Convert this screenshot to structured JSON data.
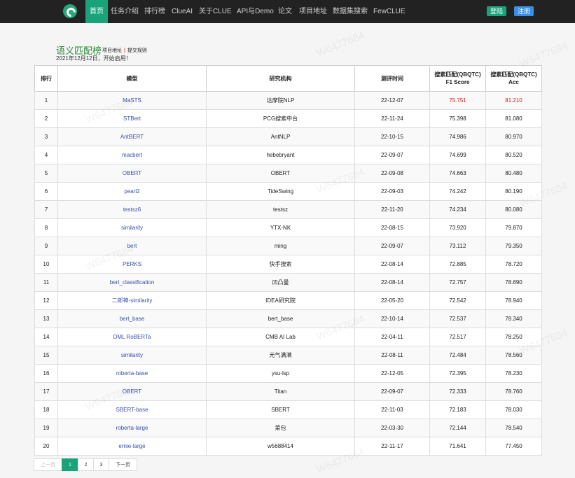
{
  "nav": {
    "items": [
      "首页",
      "任务介绍",
      "排行榜",
      "ClueAI",
      "关于CLUE",
      "API与Demo",
      "论文",
      "项目地址",
      "数据集搜索",
      "FewCLUE"
    ],
    "login": "登陆",
    "register": "注册"
  },
  "page": {
    "title": "语义匹配榜",
    "link1": "项目地址",
    "separator": "|",
    "link2": "提交规则",
    "date_note": "2021年12月12日，开始启用！"
  },
  "table": {
    "headers": [
      "排行",
      "模型",
      "研究机构",
      "测评时间",
      "搜索匹配(QBQTC)\nF1 Score",
      "搜索匹配(QBQTC)\nAcc"
    ],
    "rows": [
      [
        "1",
        "MaSTS",
        "达摩院NLP",
        "22-12-07",
        "75.751",
        "81.210"
      ],
      [
        "2",
        "STBert",
        "PCG搜索中台",
        "22-11-24",
        "75.398",
        "81.080"
      ],
      [
        "3",
        "AntBERT",
        "AntNLP",
        "22-10-15",
        "74.986",
        "80.970"
      ],
      [
        "4",
        "macbert",
        "hebebryant",
        "22-09-07",
        "74.699",
        "80.520"
      ],
      [
        "5",
        "OBERT",
        "OBERT",
        "22-09-08",
        "74.663",
        "80.480"
      ],
      [
        "6",
        "pearl2",
        "TideSwing",
        "22-09-03",
        "74.242",
        "80.190"
      ],
      [
        "7",
        "testsz6",
        "testsz",
        "22-11-20",
        "74.234",
        "80.080"
      ],
      [
        "8",
        "similarity",
        "YTX-NK",
        "22-08-15",
        "73.920",
        "79.870"
      ],
      [
        "9",
        "bert",
        "ming",
        "22-09-07",
        "73.112",
        "79.350"
      ],
      [
        "10",
        "PERKS",
        "快手搜索",
        "22-08-14",
        "72.885",
        "78.720"
      ],
      [
        "11",
        "bert_classification",
        "凹凸曼",
        "22-08-14",
        "72.757",
        "78.690"
      ],
      [
        "12",
        "二郎神-similarity",
        "IDEA研究院",
        "22-05-20",
        "72.542",
        "78.940"
      ],
      [
        "13",
        "bert_base",
        "bert_base",
        "22-10-14",
        "72.537",
        "78.340"
      ],
      [
        "14",
        "DML RoBERTa",
        "CMB AI Lab",
        "22-04-11",
        "72.517",
        "78.250"
      ],
      [
        "15",
        "similarity",
        "元气满满",
        "22-08-11",
        "72.484",
        "78.560"
      ],
      [
        "16",
        "roberta-base",
        "ysu-lsp",
        "22-12-05",
        "72.395",
        "78.230"
      ],
      [
        "17",
        "OBERT",
        "Titan",
        "22-09-07",
        "72.333",
        "78.760"
      ],
      [
        "18",
        "SBERT-base",
        "SBERT",
        "22-11-03",
        "72.183",
        "78.030"
      ],
      [
        "19",
        "roberta-large",
        "菜包",
        "22-03-30",
        "72.144",
        "78.540"
      ],
      [
        "20",
        "ernie-large",
        "w5688414",
        "22-11-17",
        "71.641",
        "77.450"
      ]
    ]
  },
  "pagination": {
    "prev": "上一页",
    "pages": [
      "1",
      "2",
      "3"
    ],
    "next": "下一页"
  },
  "watermark": "W6477684",
  "colors": {
    "navbar": "#222222",
    "accent": "#1aa37a",
    "title_green": "#2a8a3a",
    "link_blue": "#3a4fa8",
    "highlight_red": "#d62020",
    "register_blue": "#3a8ee6"
  }
}
